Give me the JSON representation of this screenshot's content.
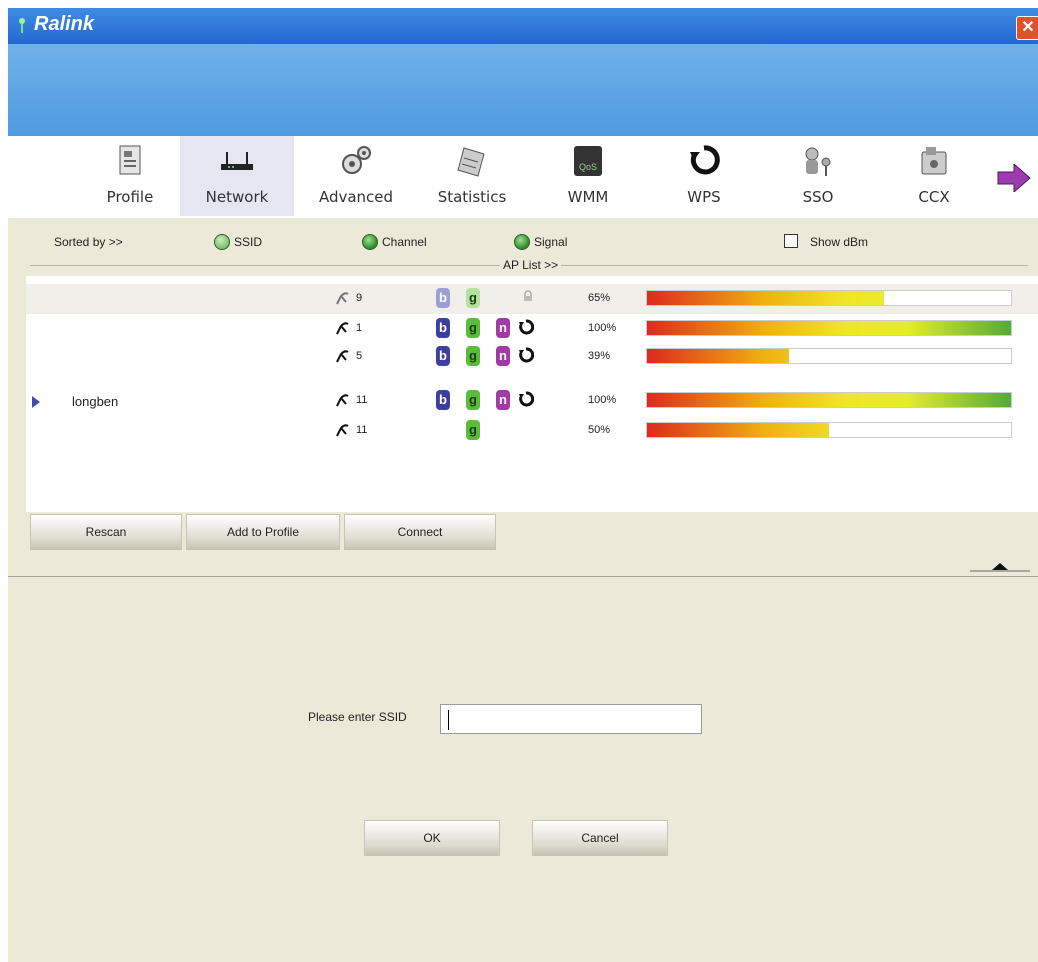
{
  "window": {
    "title": "Ralink",
    "close_icon": "close-icon"
  },
  "toolbar": {
    "items": [
      {
        "label": "Profile",
        "icon": "profile-icon",
        "selected": false
      },
      {
        "label": "Network",
        "icon": "router-icon",
        "selected": true
      },
      {
        "label": "Advanced",
        "icon": "gears-icon",
        "selected": false
      },
      {
        "label": "Statistics",
        "icon": "statistics-icon",
        "selected": false
      },
      {
        "label": "WMM",
        "icon": "qos-icon",
        "selected": false
      },
      {
        "label": "WPS",
        "icon": "wps-icon",
        "selected": false
      },
      {
        "label": "SSO",
        "icon": "sso-icon",
        "selected": false
      },
      {
        "label": "CCX",
        "icon": "ccx-icon",
        "selected": false
      }
    ],
    "more_icon": "arrow-right-icon"
  },
  "sort": {
    "label": "Sorted by >>",
    "options": [
      {
        "label": "SSID",
        "selected": false
      },
      {
        "label": "Channel",
        "selected": true
      },
      {
        "label": "Signal",
        "selected": true
      }
    ],
    "show_dbm": {
      "label": "Show dBm",
      "checked": false
    },
    "ap_list_label": "AP List >>"
  },
  "ap_list": [
    {
      "ssid": "",
      "channel": "9",
      "b": true,
      "g": true,
      "n": false,
      "wps": false,
      "signal_text": "65%",
      "signal": 0.65,
      "faded": true,
      "selected": true
    },
    {
      "ssid": "",
      "channel": "1",
      "b": true,
      "g": true,
      "n": true,
      "wps": true,
      "signal_text": "100%",
      "signal": 1.0,
      "faded": false,
      "selected": false
    },
    {
      "ssid": "",
      "channel": "5",
      "b": true,
      "g": true,
      "n": true,
      "wps": true,
      "signal_text": "39%",
      "signal": 0.39,
      "faded": false,
      "selected": false
    },
    {
      "ssid": "longben",
      "channel": "11",
      "b": true,
      "g": true,
      "n": true,
      "wps": true,
      "signal_text": "100%",
      "signal": 1.0,
      "faded": false,
      "selected": false,
      "current": true
    },
    {
      "ssid": "",
      "channel": "11",
      "b": false,
      "g": true,
      "n": false,
      "wps": false,
      "signal_text": "50%",
      "signal": 0.5,
      "faded": false,
      "selected": false
    }
  ],
  "actions": {
    "rescan": "Rescan",
    "add_to_profile": "Add to Profile",
    "connect": "Connect"
  },
  "ssid_form": {
    "label": "Please enter SSID",
    "value": "",
    "ok": "OK",
    "cancel": "Cancel"
  },
  "colors": {
    "title_bar": "#2468d3",
    "banner": "#5aa3e4",
    "panel": "#ece9d8"
  }
}
